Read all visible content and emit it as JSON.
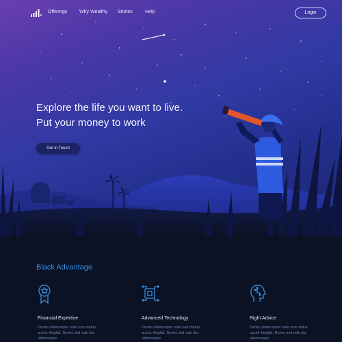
{
  "nav": {
    "items": [
      {
        "label": "Offerings"
      },
      {
        "label": "Why Wealthy"
      },
      {
        "label": "Stories"
      },
      {
        "label": "Help"
      }
    ],
    "login_label": "Login"
  },
  "hero": {
    "headline_line1": "Explore the life you want to live.",
    "headline_line2": "Put your money to work",
    "cta_label": "Get in Touch"
  },
  "advantage": {
    "title": "Black Advantage",
    "features": [
      {
        "icon": "medal-icon",
        "title": "Financial Expertise",
        "desc": "Donec ullamcorper nulla non metus auctor fringilla. Donec sed odio dui. ullamcorper."
      },
      {
        "icon": "chip-icon",
        "title": "Advanced Technology",
        "desc": "Donec ullamcorper nulla non metus auctor fringilla. Donec sed odio dui. ullamcorper."
      },
      {
        "icon": "brain-icon",
        "title": "Right Advice",
        "desc": "Donec ullamcorper nulla non metus auctor fringilla. Donec sed odio dui. ullamcorper."
      }
    ]
  },
  "colors": {
    "accent_blue": "#3a8fe0",
    "hero_purple": "#6a3fb0",
    "hero_blue": "#232f8e",
    "page_bg": "#0b1224"
  }
}
